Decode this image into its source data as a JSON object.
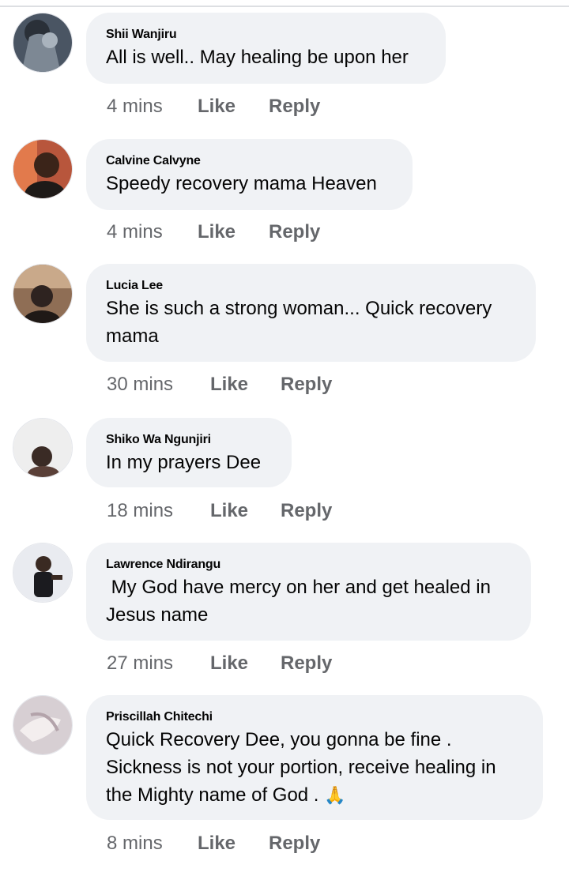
{
  "comments": [
    {
      "author": "Shii Wanjiru",
      "text": "All is well.. May healing be upon her",
      "time": "4 mins",
      "avatar": "dark-portrait"
    },
    {
      "author": "Calvine Calvyne",
      "text": "Speedy recovery mama Heaven",
      "time": "4 mins",
      "avatar": "portrait"
    },
    {
      "author": "Lucia Lee",
      "text": "She is such a strong woman... Quick recovery mama",
      "time": "30 mins",
      "avatar": "portrait"
    },
    {
      "author": "Shiko Wa Ngunjiri",
      "text": "In my prayers Dee",
      "time": "18 mins",
      "avatar": "portrait"
    },
    {
      "author": "Lawrence Ndirangu",
      "text": " My God have mercy on her and get healed in Jesus name",
      "time": "27 mins",
      "avatar": "portrait"
    },
    {
      "author": "Priscillah Chitechi",
      "text": "Quick Recovery Dee, you gonna be fine . Sickness is not your portion, receive healing in the Mighty name of God .",
      "time": "8 mins",
      "avatar": "hands",
      "emoji": "🙏"
    }
  ],
  "actions": {
    "like": "Like",
    "reply": "Reply"
  }
}
